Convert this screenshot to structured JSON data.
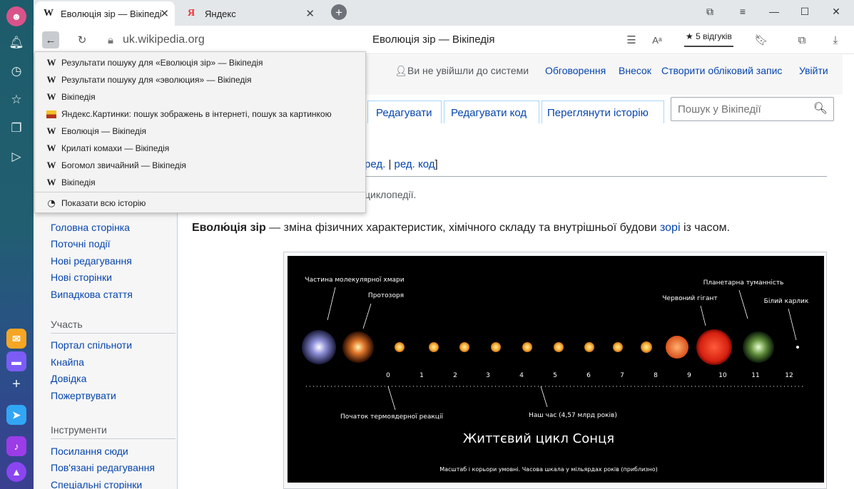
{
  "browser": {
    "tabs": [
      {
        "label": "Еволюція зір — Вікіпеді",
        "favicon": "W"
      },
      {
        "label": "Яндекс",
        "favicon": "Я"
      }
    ],
    "address": "uk.wikipedia.org",
    "page_title": "Еволюція зір — Вікіпедія",
    "reviews": "5 відгуків"
  },
  "history_dropdown": {
    "items": [
      {
        "label": "Результати пошуку для «Еволюція зір» — Вікіпедія",
        "icon": "W"
      },
      {
        "label": "Результати пошуку для «эволюция» — Вікіпедія",
        "icon": "W"
      },
      {
        "label": "Вікіпедія",
        "icon": "W"
      },
      {
        "label": "Яндекс.Картинки: пошук зображень в інтернеті, пошук за картинкою",
        "icon": "image-icon"
      },
      {
        "label": "Еволюція — Вікіпедія",
        "icon": "W"
      },
      {
        "label": "Крилаті комахи — Вікіпедія",
        "icon": "W"
      },
      {
        "label": "Богомол звичайний — Вікіпедія",
        "icon": "W"
      },
      {
        "label": "Вікіпедія",
        "icon": "W"
      }
    ],
    "show_all": "Показати всю історію"
  },
  "wiki": {
    "personal": {
      "not_logged": "Ви не увійшли до системи",
      "talk": "Обговорення",
      "contributions": "Внесок",
      "create_account": "Створити обліковий запис",
      "login": "Увійти"
    },
    "tabs": {
      "edit": "Редагувати",
      "edit_source": "Редагувати код",
      "history": "Переглянути історію"
    },
    "search_placeholder": "Пошук у Вікіпедії",
    "edit_links": {
      "edit": "ред.",
      "sep": "|",
      "edit_code": "ред. код",
      "close": "]"
    },
    "tagline": "циклопедії.",
    "lead": {
      "bold": "Еволю́ція зір",
      "text": " — зміна фізичних характеристик, хімічного складу та внутрішньої будови ",
      "link": "зорі",
      "end": " із часом."
    },
    "sidebar": {
      "nav": [
        "Головна сторінка",
        "Поточні події",
        "Нові редагування",
        "Нові сторінки",
        "Випадкова стаття"
      ],
      "participate_head": "Участь",
      "participate": [
        "Портал спільноти",
        "Кнайпа",
        "Довідка",
        "Пожертвувати"
      ],
      "tools_head": "Інструменти",
      "tools": [
        "Посилання сюди",
        "Пов'язані редагування",
        "Спеціальні сторінки"
      ]
    },
    "figure": {
      "labels": {
        "cloud": "Частина молекулярної хмари",
        "protostar": "Протозоря",
        "nebula": "Планетарна туманність",
        "red_giant": "Червоний гігант",
        "white_dwarf": "Білий карлик",
        "fusion": "Початок термоядерної реакції",
        "now": "Наш час (4,57 млрд років)",
        "title": "Життєвий цикл Сонця",
        "scale": "Масштаб і корьори умовні. Часова шкала у мільярдах років (приблизно)"
      },
      "ticks": [
        "0",
        "1",
        "2",
        "3",
        "4",
        "5",
        "6",
        "7",
        "8",
        "9",
        "10",
        "11",
        "12"
      ]
    }
  }
}
